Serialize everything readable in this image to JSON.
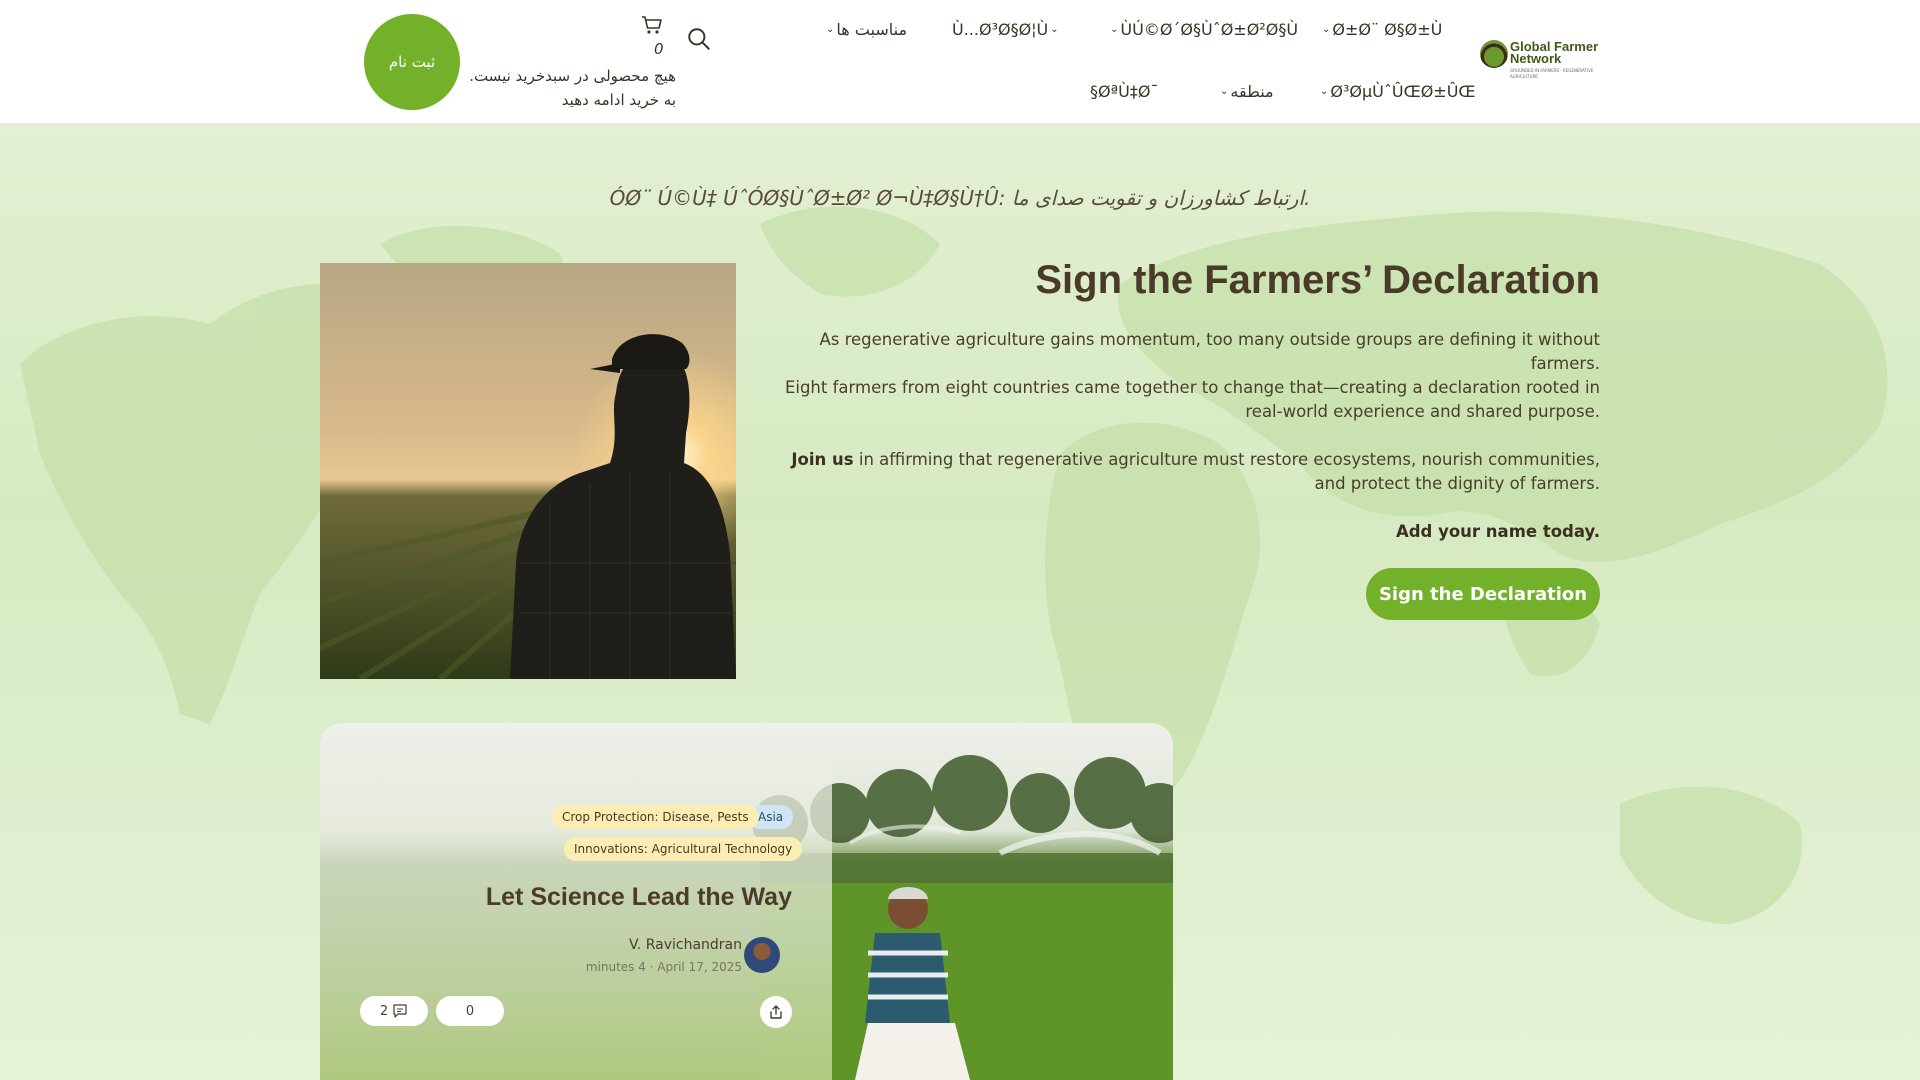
{
  "header": {
    "logo": {
      "line1": "Global Farmer",
      "line2": "Network",
      "tagline": "GROUNDED IN FARMERS · REGENERATIVE AGRICULTURE"
    },
    "nav_row1": [
      {
        "label": "Ø±Ø¨ Ø§Ø±Ù"
      },
      {
        "label": "ÙÚ©Ø´Ø§ÙˆØ±Ø²Ø§Ù"
      },
      {
        "label": "Ù...Ø³Ø§Ø¦Ù"
      },
      {
        "label": "مناسبت ها"
      }
    ],
    "nav_row2": [
      {
        "label": "Ø³ØµÙˆÛŒØ±ÛŒ"
      },
      {
        "label": "منطقه"
      },
      {
        "label": "§ØªÙ‡Ø¯"
      }
    ],
    "cart": {
      "count": "0",
      "empty_line1": "هیچ محصولی در سبدخرید نیست.",
      "empty_line2": "به خرید ادامه دهید"
    },
    "register_label": "ثبت نام"
  },
  "hero": {
    "tagline": "ÓØ¨ Ú©Ù‡ ÚˆÓØ§ÙˆØ±Ø² Ø¬Ù‡Ø§Ù†Û: ارتباط کشاورزان و تقویت صدای ما.",
    "title": "Sign the Farmers’ Declaration",
    "p1": "As regenerative agriculture gains momentum, too many outside groups are defining it without farmers.",
    "p2": "Eight farmers from eight countries came together to change that—creating a declaration rooted in real-world experience and shared purpose.",
    "p3_bold": "Join us",
    "p3_rest": " in affirming that regenerative agriculture must restore ecosystems, nourish communities, and protect the dignity of farmers.",
    "p4": "Add your name today.",
    "cta": "Sign the Declaration"
  },
  "card": {
    "tags": [
      "Asia",
      "Crop Protection: Disease, Pests",
      "Innovations: Agricultural Technology"
    ],
    "title": "Let Science Lead the Way",
    "author": "V. Ravichandran",
    "meta": "minutes 4 · April 17, 2025",
    "likes": "0",
    "comments": "2"
  },
  "colors": {
    "accent": "#73b12b",
    "background": "#dcebc9",
    "text": "#4a3a2a"
  }
}
